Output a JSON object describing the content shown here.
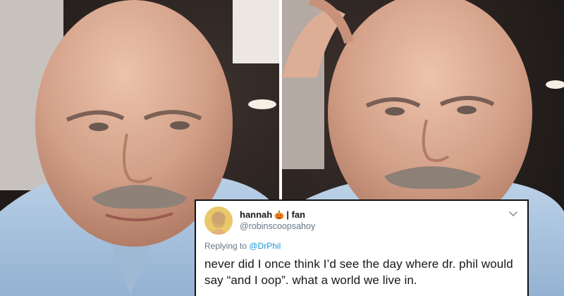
{
  "tweet": {
    "display_name": "hannah",
    "name_emoji": "pumpkin-icon",
    "name_suffix": "| fan",
    "handle": "@robinscoopsahoy",
    "replying_prefix": "Replying to",
    "replying_to": "@DrPhil",
    "text": "never did I once think I’d see the day where dr. phil would say “and I oop”. what a world we live in."
  },
  "colors": {
    "mention": "#1b95e0",
    "secondary_text": "#657786",
    "primary_text": "#14171a",
    "shirt": "#a9c3dc",
    "skin": "#d09a80"
  }
}
